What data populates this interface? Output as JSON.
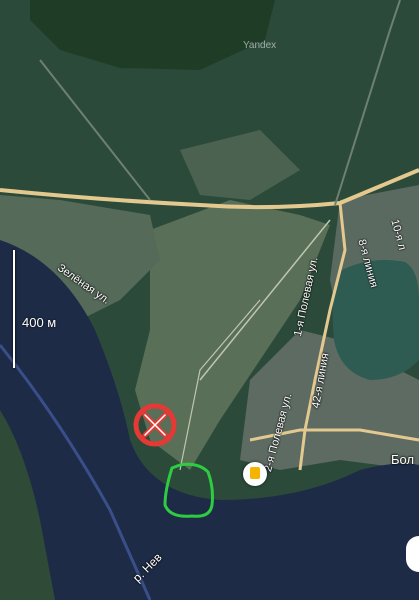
{
  "map": {
    "watermark": "Yandex",
    "scale_label": "400 м",
    "river_label": "р. Нев",
    "place_label": "Бол",
    "streets": {
      "zelenaya": "Зелёная ул.",
      "polevaya1": "1-я Полевая ул.",
      "polevaya2": "2-я Полевая ул.",
      "liniya42": "42-я линия",
      "liniya8": "8-я линия",
      "liniya10": "10-я л"
    },
    "markers": {
      "crossed_marker_icon": "red-circle-with-white-x",
      "highlight_icon": "green-hand-drawn-outline",
      "poi_icon": "yellow-bookmark-pin"
    },
    "colors": {
      "river": "#1d2b46",
      "forest": "#2c4a3a",
      "road": "#e3c98f",
      "cross_marker": "#e53935",
      "highlight": "#2ecc40"
    }
  }
}
